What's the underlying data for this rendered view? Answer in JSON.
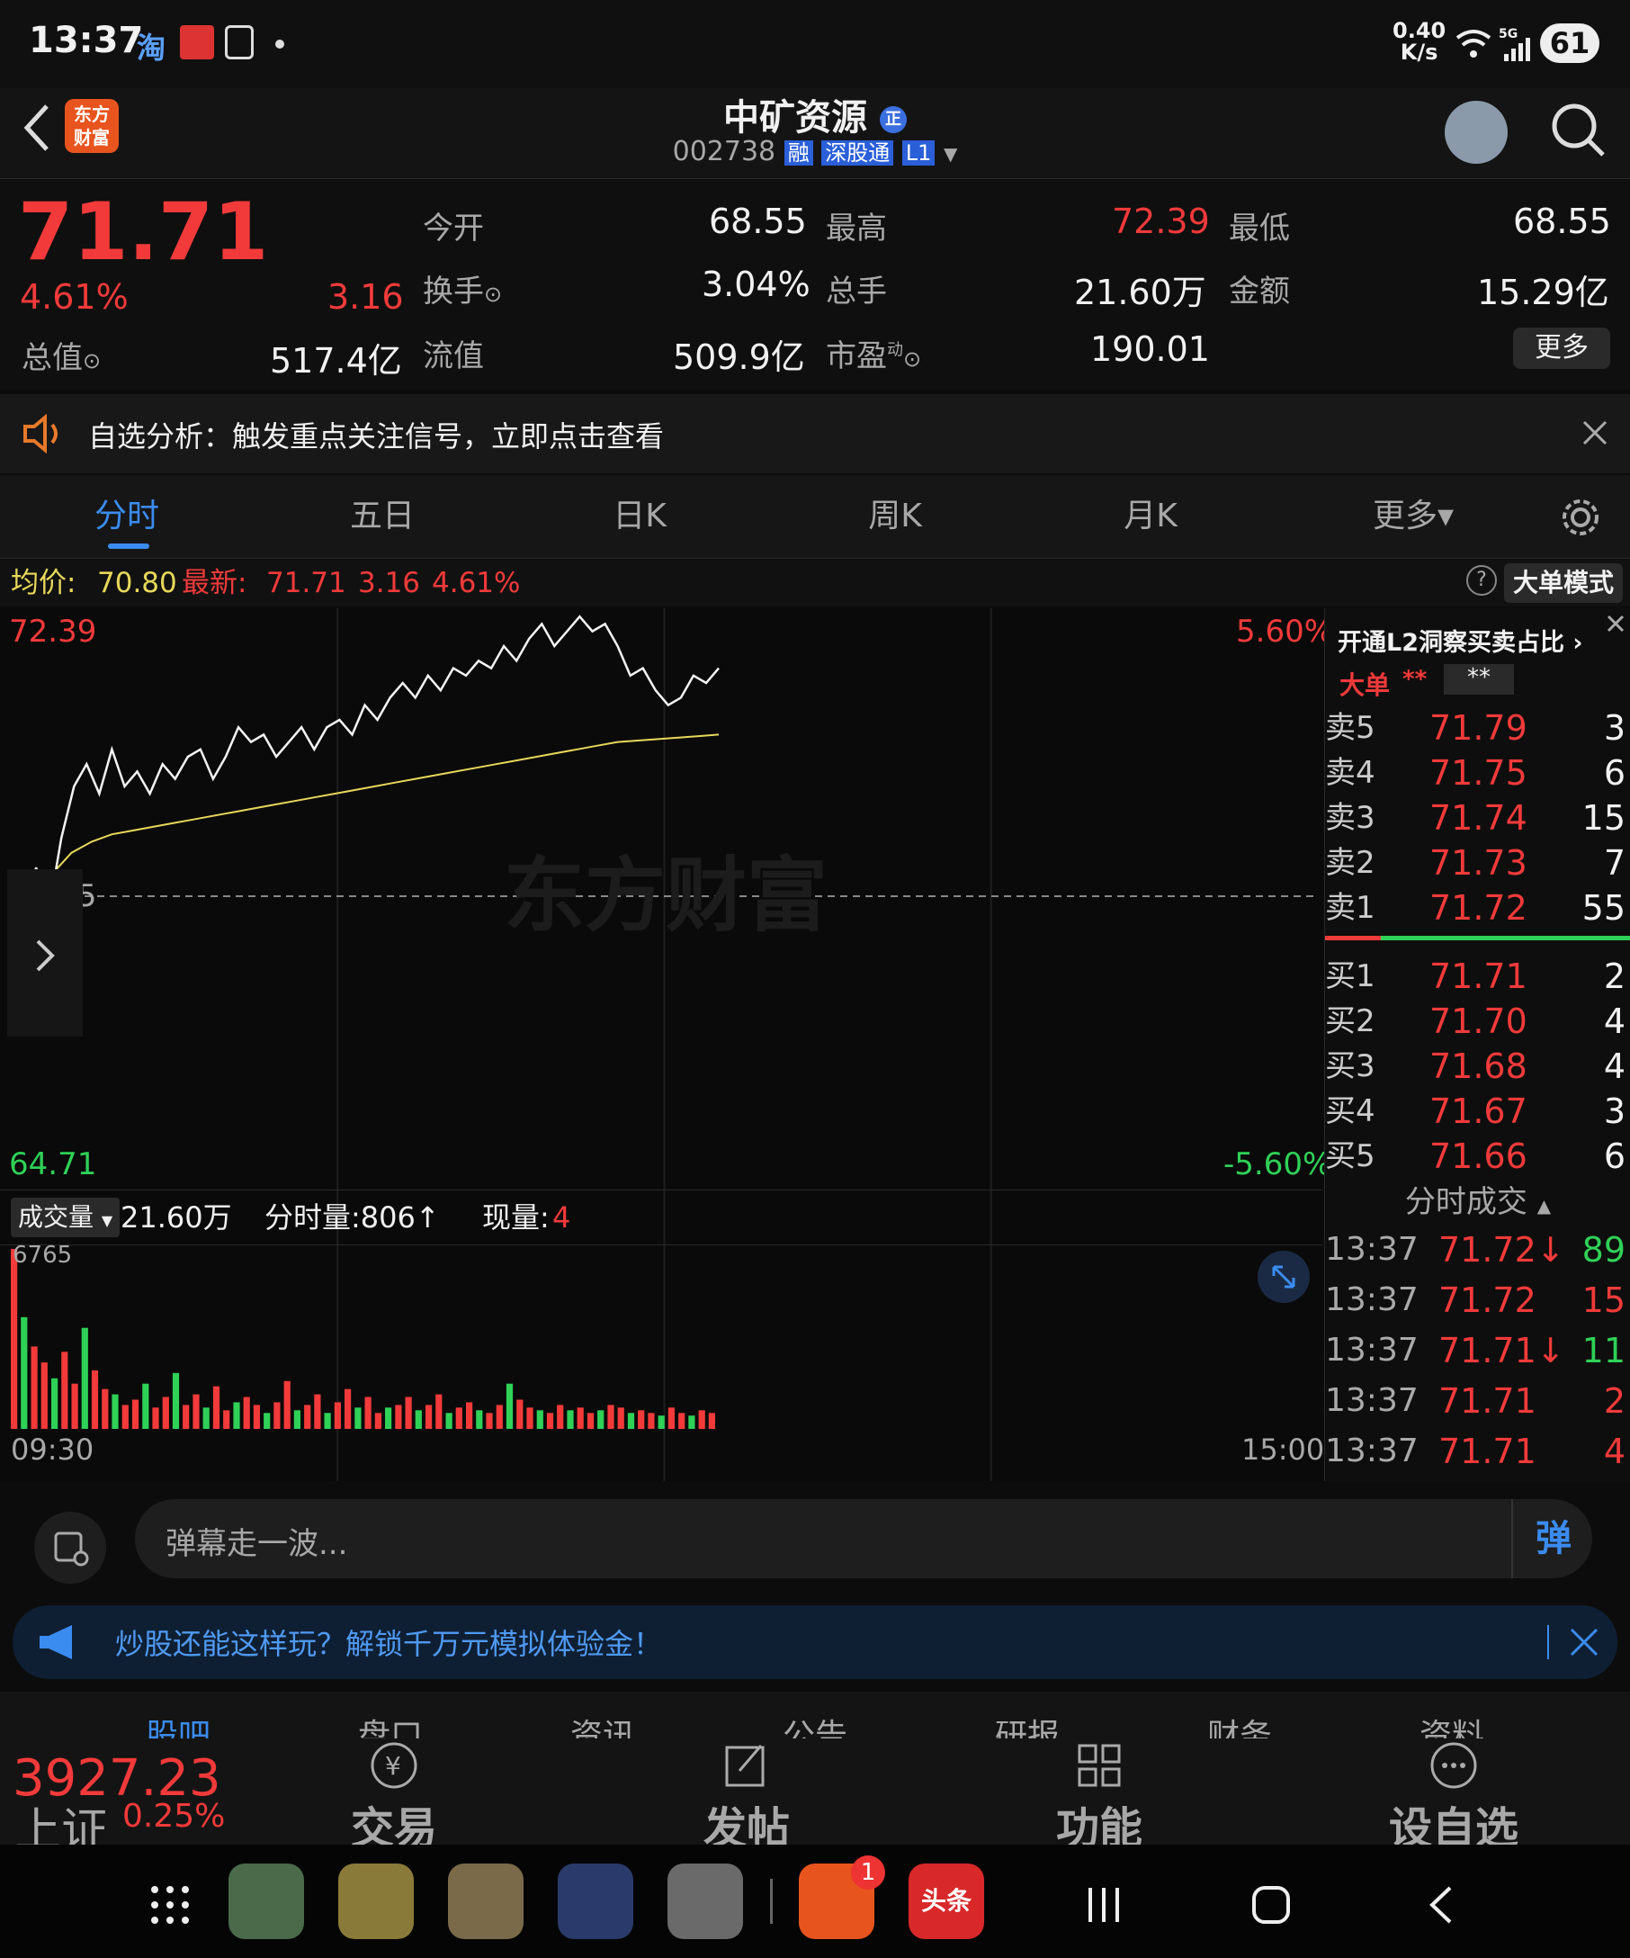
{
  "status_bar": {
    "time": "13:37",
    "net_speed_top": "0.40",
    "net_speed_bottom": "K/s",
    "signal": "5G",
    "battery": "61"
  },
  "header": {
    "app_logo": "东方\n财富",
    "stock_name": "中矿资源",
    "stock_code": "002738",
    "badges": [
      "融",
      "深股通",
      "L1"
    ]
  },
  "quote": {
    "price": "71.71",
    "change_pct": "4.61%",
    "change": "3.16",
    "open_label": "今开",
    "open": "68.55",
    "high_label": "最高",
    "high": "72.39",
    "low_label": "最低",
    "low": "68.55",
    "turnover_label": "换手",
    "turnover": "3.04%",
    "volume_label": "总手",
    "volume": "21.60万",
    "amount_label": "金额",
    "amount": "15.29亿",
    "mktcap_label": "总值",
    "mktcap": "517.4亿",
    "float_label": "流值",
    "float": "509.9亿",
    "pe_label": "市盈",
    "pe_sup": "动",
    "pe": "190.01",
    "more": "更多"
  },
  "notice": {
    "text": "自选分析：触发重点关注信号，立即点击查看"
  },
  "tabs": [
    "分时",
    "五日",
    "日K",
    "周K",
    "月K",
    "更多▾"
  ],
  "infoline": {
    "avg_label": "均价:",
    "avg": "70.80",
    "last_label": "最新:",
    "last": "71.71",
    "chg": "3.16",
    "pct": "4.61%",
    "mode": "大单模式"
  },
  "chart": {
    "y_top": "72.39",
    "y_mid": "68.55",
    "y_bot": "64.71",
    "pct_top": "5.60%",
    "pct_bot": "-5.60%",
    "watermark": "东方财富",
    "vol_label": "成交量",
    "vol_total": "21.60万",
    "min_vol": "分时量:806↑",
    "cur_vol_label": "现量:",
    "cur_vol": "4",
    "vol_max": "6765",
    "time_start": "09:30",
    "time_end": "15:00"
  },
  "chart_data": {
    "type": "line",
    "x_range": [
      "09:30",
      "15:00"
    ],
    "ylim": [
      64.71,
      72.39
    ],
    "base": 68.55,
    "series": [
      {
        "values": [
          68.5,
          68.2,
          69.0,
          68.4,
          69.4,
          70.1,
          70.4,
          70.0,
          70.6,
          70.1,
          70.3,
          70.0,
          70.4,
          70.2,
          70.5,
          70.6,
          70.2,
          70.5,
          70.9,
          70.7,
          70.8,
          70.5,
          70.7,
          70.9,
          70.6,
          70.9,
          71.0,
          70.8,
          71.2,
          71.0,
          71.3,
          71.5,
          71.3,
          71.6,
          71.4,
          71.7,
          71.6,
          71.8,
          71.7,
          72.0,
          71.8,
          72.1,
          72.3,
          72.0,
          72.2,
          72.4,
          72.2,
          72.3,
          72.0,
          71.6,
          71.7,
          71.4,
          71.2,
          71.3,
          71.6,
          71.5,
          71.7
        ]
      },
      {
        "values": [
          68.5,
          68.6,
          68.9,
          69.2,
          69.35,
          69.45,
          69.5,
          69.55,
          69.6,
          69.65,
          69.7,
          69.75,
          69.8,
          69.85,
          69.9,
          69.95,
          70.0,
          70.05,
          70.1,
          70.15,
          70.2,
          70.25,
          70.3,
          70.35,
          70.4,
          70.45,
          70.5,
          70.55,
          70.6,
          70.65,
          70.7,
          70.72,
          70.74,
          70.76,
          70.78,
          70.8
        ]
      }
    ],
    "volume": [
      6765,
      4200,
      3100,
      2500,
      1900,
      2900,
      1700,
      3800,
      2200,
      1500,
      1300,
      900,
      1100,
      1700,
      800,
      1200,
      2100,
      900,
      1300,
      800,
      1600,
      700,
      1000,
      1200,
      900,
      600,
      1000,
      1800,
      700,
      900,
      1300,
      600,
      1000,
      1500,
      800,
      1200,
      600,
      800,
      900,
      1200,
      700,
      900,
      1300,
      600,
      800,
      1000,
      700,
      600,
      900,
      1700,
      1100,
      800,
      700,
      600,
      900,
      700,
      800,
      600,
      700,
      900,
      800,
      600,
      700,
      600,
      500,
      800,
      600,
      500,
      700,
      600
    ]
  },
  "book": {
    "header": "开通L2洞察买卖占比",
    "bigorder": "大单",
    "stars1": "**",
    "stars2": "**",
    "asks": [
      [
        "卖5",
        "71.79",
        "3"
      ],
      [
        "卖4",
        "71.75",
        "6"
      ],
      [
        "卖3",
        "71.74",
        "15"
      ],
      [
        "卖2",
        "71.73",
        "7"
      ],
      [
        "卖1",
        "71.72",
        "55"
      ]
    ],
    "bids": [
      [
        "买1",
        "71.71",
        "2"
      ],
      [
        "买2",
        "71.70",
        "4"
      ],
      [
        "买3",
        "71.68",
        "4"
      ],
      [
        "买4",
        "71.67",
        "3"
      ],
      [
        "买5",
        "71.66",
        "6"
      ]
    ],
    "trades_title": "分时成交",
    "trades": [
      [
        "13:37",
        "71.72↓",
        "89"
      ],
      [
        "13:37",
        "71.72",
        "15"
      ],
      [
        "13:37",
        "71.71↓",
        "11"
      ],
      [
        "13:37",
        "71.71",
        "2"
      ],
      [
        "13:37",
        "71.71",
        "4"
      ]
    ]
  },
  "comment": {
    "placeholder": "弹幕走一波...",
    "button": "弹"
  },
  "banner": {
    "text": "炒股还能这样玩？解锁千万元模拟体验金！"
  },
  "subtabs": [
    "股吧",
    "盘口",
    "资讯",
    "公告",
    "研报",
    "财务",
    "资料"
  ],
  "index": {
    "value": "3927.23",
    "name": "上证",
    "pct": "0.25%"
  },
  "toolbar": [
    "交易",
    "发帖",
    "功能",
    "设自选"
  ],
  "nav": {
    "badge": "1",
    "toutiao": "头条"
  },
  "colors": {
    "up": "#f23a3a",
    "down": "#2fd157",
    "avg_line": "#e8d85a",
    "accent": "#3b8cf0"
  }
}
